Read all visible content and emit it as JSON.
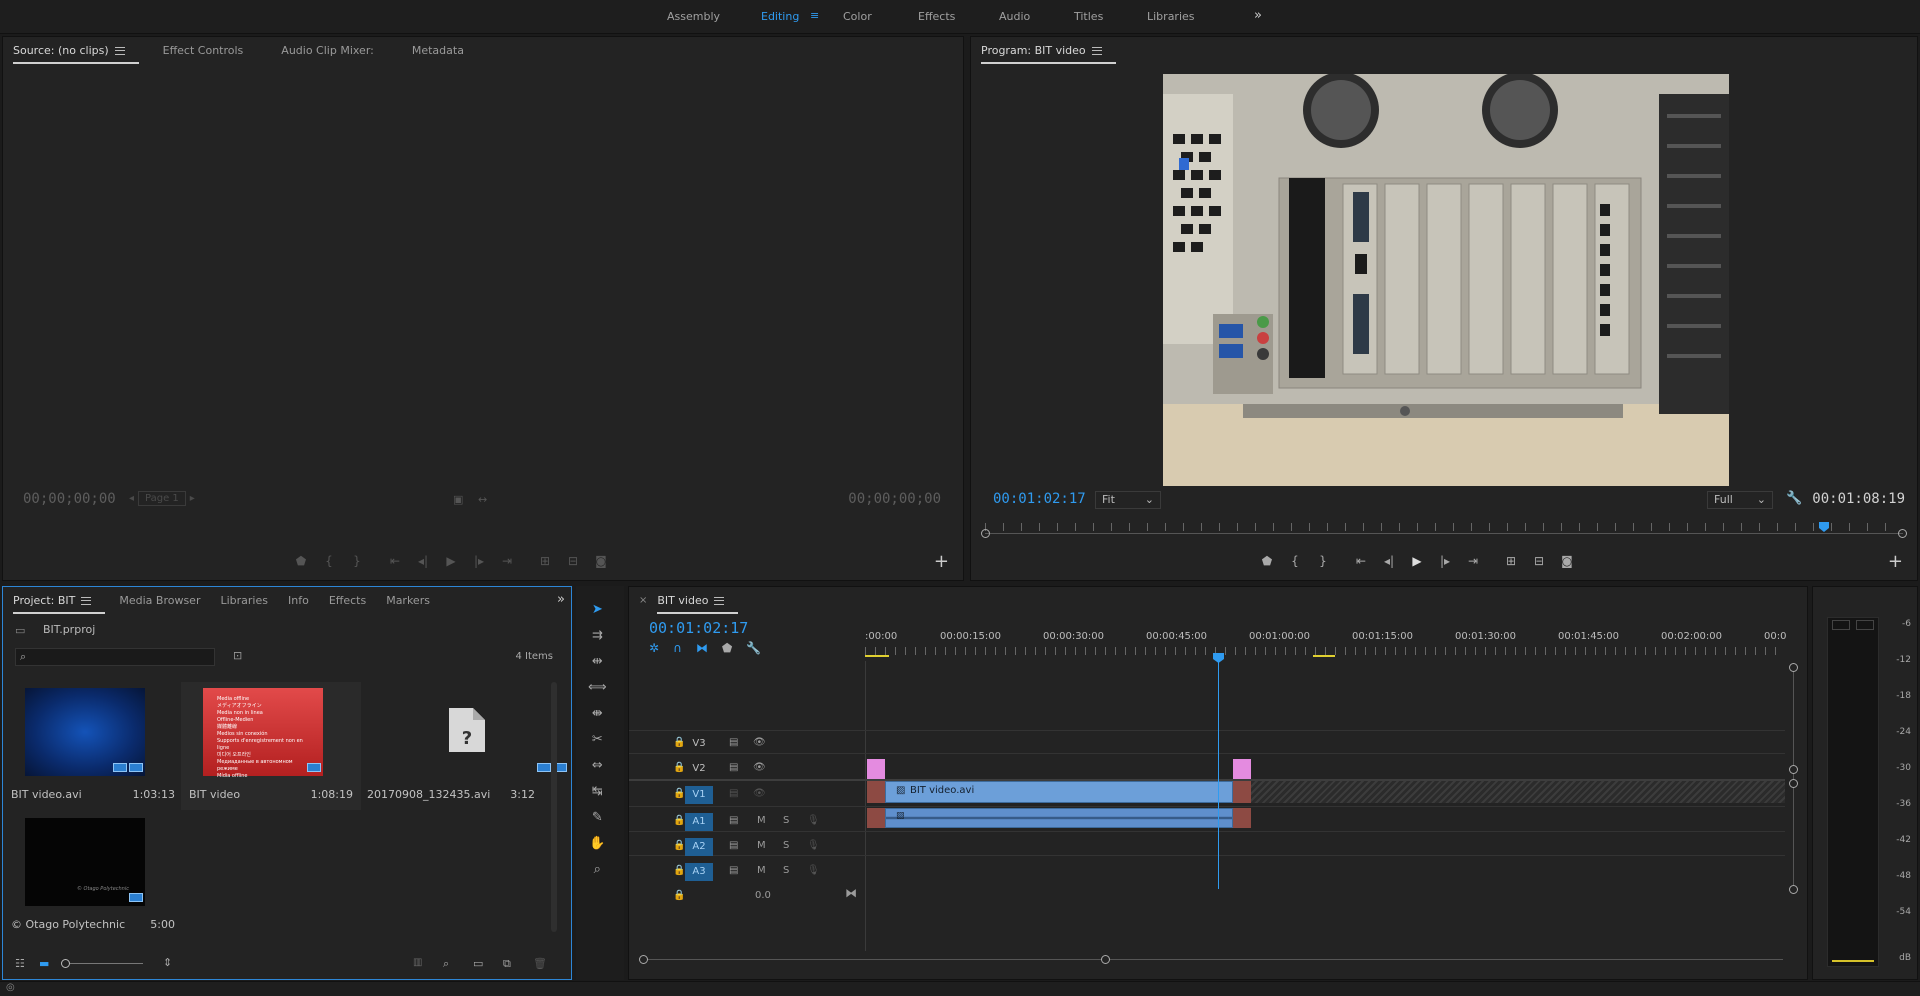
{
  "workspaces": {
    "items": [
      "Assembly",
      "Editing",
      "Color",
      "Effects",
      "Audio",
      "Titles",
      "Libraries"
    ],
    "active": "Editing",
    "overflow": "»"
  },
  "source_panel": {
    "tabs": [
      "Source: (no clips)",
      "Effect Controls",
      "Audio Clip Mixer:",
      "Metadata"
    ],
    "timecode_left": "00;00;00;00",
    "timecode_right": "00;00;00;00",
    "page_label": "Page 1"
  },
  "program_panel": {
    "title": "Program: BIT video",
    "timecode_current": "00:01:02:17",
    "timecode_duration": "00:01:08:19",
    "zoom_select": "Fit",
    "resolution_select": "Full"
  },
  "project_panel": {
    "tabs": [
      "Project: BIT",
      "Media Browser",
      "Libraries",
      "Info",
      "Effects",
      "Markers"
    ],
    "project_file": "BIT.prproj",
    "items_count": "4 Items",
    "items": [
      {
        "name": "BIT video.avi",
        "duration": "1:03:13"
      },
      {
        "name": "BIT video",
        "duration": "1:08:19"
      },
      {
        "name": "20170908_132435.avi",
        "duration": "3:12"
      },
      {
        "name": "© Otago Polytechnic",
        "duration": "5:00"
      }
    ],
    "red_thumb_lines": [
      "Media offline",
      "メディアオフライン",
      "Media non in linea",
      "Offline-Medien",
      "媒體離線",
      "Medios sin conexión",
      "Supports d'enregistrement non en ligne",
      "미디어 오프라인",
      "Медиаданные в автономном режиме",
      "Mídia offline"
    ],
    "watermark": "© Otago Polytechnic"
  },
  "timeline_panel": {
    "title": "BIT video",
    "timecode": "00:01:02:17",
    "ruler": [
      ":00:00",
      "00:00:15:00",
      "00:00:30:00",
      "00:00:45:00",
      "00:01:00:00",
      "00:01:15:00",
      "00:01:30:00",
      "00:01:45:00",
      "00:02:00:00",
      "00:0"
    ],
    "video_tracks": [
      "V3",
      "V2",
      "V1"
    ],
    "audio_tracks": [
      "A1",
      "A2",
      "A3"
    ],
    "master_level": "0.0",
    "clip_name": "BIT video.avi",
    "track_buttons": {
      "mute": "M",
      "solo": "S"
    }
  },
  "audio_meter": {
    "scale": [
      "-6",
      "-12",
      "-18",
      "-24",
      "-30",
      "-36",
      "-42",
      "-48",
      "-54",
      "dB"
    ]
  },
  "colors": {
    "accent": "#2f9bf0",
    "panel_bg": "#232323",
    "clip_video": "#6c9fd9",
    "clip_audio": "#5f8fcd",
    "transition_pink": "#e48be0"
  }
}
